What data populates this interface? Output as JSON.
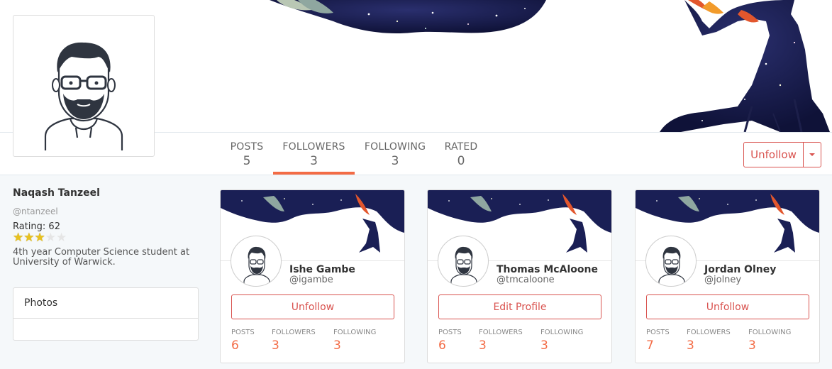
{
  "profile": {
    "name": "Naqash Tanzeel",
    "handle": "@ntanzeel",
    "rating_label": "Rating: 62",
    "rating_stars": 3,
    "rating_max": 5,
    "bio": "4th year Computer Science student at University of Warwick."
  },
  "stats": [
    {
      "label": "POSTS",
      "value": "5",
      "active": false
    },
    {
      "label": "FOLLOWERS",
      "value": "3",
      "active": true
    },
    {
      "label": "FOLLOWING",
      "value": "3",
      "active": false
    },
    {
      "label": "RATED",
      "value": "0",
      "active": false
    }
  ],
  "actions": {
    "unfollow_label": "Unfollow"
  },
  "photos": {
    "title": "Photos"
  },
  "cards": [
    {
      "name": "Ishe Gambe",
      "handle": "@igambe",
      "button": "Unfollow",
      "stats": [
        {
          "label": "POSTS",
          "value": "6"
        },
        {
          "label": "FOLLOWERS",
          "value": "3"
        },
        {
          "label": "FOLLOWING",
          "value": "3"
        }
      ]
    },
    {
      "name": "Thomas McAloone",
      "handle": "@tmcaloone",
      "button": "Edit Profile",
      "stats": [
        {
          "label": "POSTS",
          "value": "6"
        },
        {
          "label": "FOLLOWERS",
          "value": "3"
        },
        {
          "label": "FOLLOWING",
          "value": "3"
        }
      ]
    },
    {
      "name": "Jordan Olney",
      "handle": "@jolney",
      "button": "Unfollow",
      "stats": [
        {
          "label": "POSTS",
          "value": "7"
        },
        {
          "label": "FOLLOWERS",
          "value": "3"
        },
        {
          "label": "FOLLOWING",
          "value": "3"
        }
      ]
    }
  ],
  "colors": {
    "accent": "#f36b45",
    "danger": "#d9534f",
    "star": "#e8c11e"
  }
}
